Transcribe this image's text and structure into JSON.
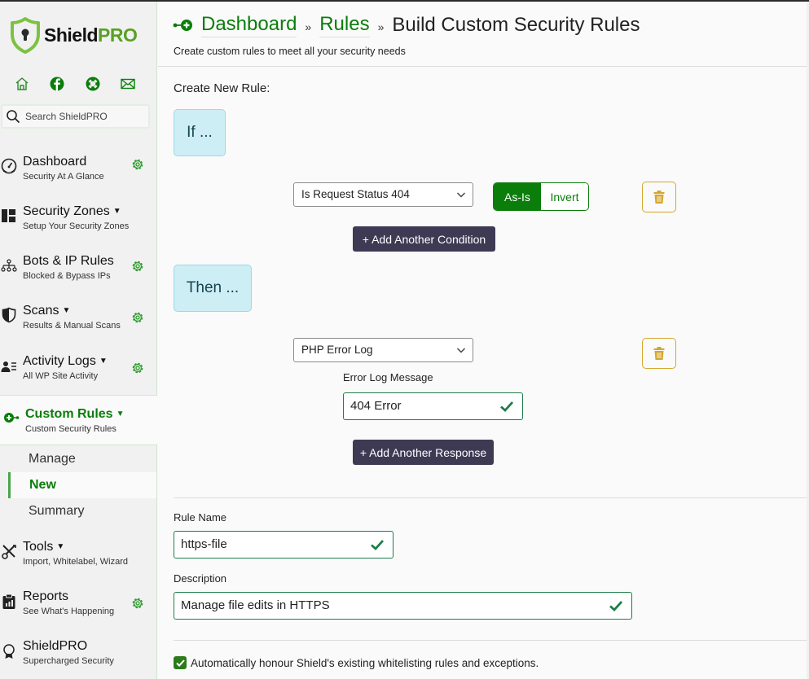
{
  "brand": {
    "name_part1": "Shield",
    "name_part2": "PRO",
    "accent": "#0a7d0a",
    "logo_green": "#5aa125"
  },
  "sidebar": {
    "social_icons": [
      "home-icon",
      "facebook-icon",
      "support-lifebuoy-icon",
      "email-icon"
    ],
    "search": {
      "placeholder": "Search ShieldPRO",
      "value": ""
    },
    "items": [
      {
        "key": "dashboard",
        "title": "Dashboard",
        "subtitle": "Security At A Glance",
        "caret": false,
        "gear": true,
        "icon": "speedometer-icon"
      },
      {
        "key": "security-zones",
        "title": "Security Zones",
        "subtitle": "Setup Your Security Zones",
        "caret": true,
        "gear": false,
        "icon": "grid-layout-icon"
      },
      {
        "key": "bots-ip-rules",
        "title": "Bots & IP Rules",
        "subtitle": "Blocked & Bypass IPs",
        "caret": false,
        "gear": true,
        "icon": "network-icon"
      },
      {
        "key": "scans",
        "title": "Scans",
        "subtitle": "Results & Manual Scans",
        "caret": true,
        "gear": true,
        "icon": "shield-half-icon"
      },
      {
        "key": "activity-logs",
        "title": "Activity Logs",
        "subtitle": "All WP Site Activity",
        "caret": true,
        "gear": true,
        "icon": "person-lines-icon"
      },
      {
        "key": "custom-rules",
        "title": "Custom Rules",
        "subtitle": "Custom Security Rules",
        "caret": true,
        "gear": false,
        "icon": "node-plus-icon",
        "active": true
      },
      {
        "key": "tools",
        "title": "Tools",
        "subtitle": "Import, Whitelabel, Wizard",
        "caret": true,
        "gear": false,
        "icon": "tools-icon"
      },
      {
        "key": "reports",
        "title": "Reports",
        "subtitle": "See What's Happening",
        "caret": false,
        "gear": true,
        "icon": "clipboard-chart-icon"
      },
      {
        "key": "shieldpro",
        "title": "ShieldPRO",
        "subtitle": "Supercharged Security",
        "caret": false,
        "gear": false,
        "icon": "award-icon"
      }
    ],
    "caret_glyph": "▼",
    "subnav": [
      {
        "label": "Manage",
        "current": false
      },
      {
        "label": "New",
        "current": true
      },
      {
        "label": "Summary",
        "current": false
      }
    ]
  },
  "header": {
    "breadcrumbs": [
      {
        "label": "Dashboard",
        "link": true
      },
      {
        "label": "Rules",
        "link": true
      },
      {
        "label": "Build Custom Security Rules",
        "link": false
      }
    ],
    "separator": "»",
    "subtitle": "Create custom rules to meet all your security needs"
  },
  "builder": {
    "section_label": "Create New Rule:",
    "if_label": "If ...",
    "then_label": "Then ...",
    "condition": {
      "selected": "Is Request Status 404",
      "mode_options": [
        "As-Is",
        "Invert"
      ],
      "mode_selected": "As-Is"
    },
    "add_condition_label": "+ Add Another Condition",
    "response": {
      "selected": "PHP Error Log",
      "param_label": "Error Log Message",
      "param_value": "404 Error"
    },
    "add_response_label": "+ Add Another Response"
  },
  "details": {
    "rule_name_label": "Rule Name",
    "rule_name_value": "https-file",
    "description_label": "Description",
    "description_value": "Manage file edits in HTTPS",
    "whitelist_checkbox": {
      "label": "Automatically honour Shield's existing whitelisting rules and exceptions.",
      "checked": true
    }
  }
}
